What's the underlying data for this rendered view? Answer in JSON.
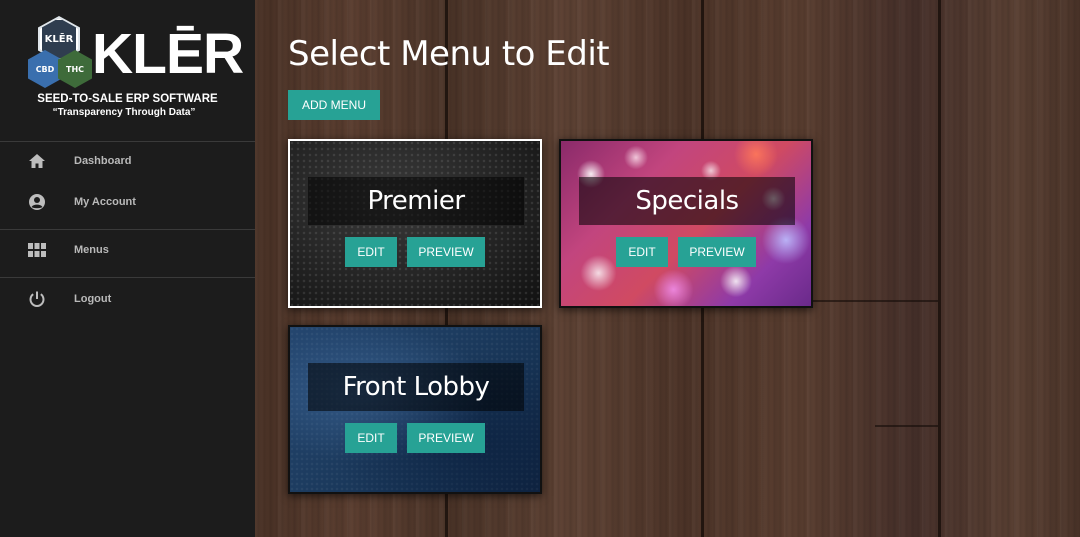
{
  "brand": {
    "logo_hex_label": "KLĒR",
    "logo_cbd": "CBD",
    "logo_thc": "THC",
    "name": "KLĒR",
    "tagline": "SEED-TO-SALE ERP SOFTWARE",
    "motto": "“Transparency Through Data”"
  },
  "sidebar": {
    "items": [
      {
        "label": "Dashboard",
        "icon": "home-icon"
      },
      {
        "label": "My Account",
        "icon": "account-circle-icon"
      },
      {
        "label": "Menus",
        "icon": "grid-icon"
      },
      {
        "label": "Logout",
        "icon": "power-icon"
      }
    ]
  },
  "main": {
    "title": "Select Menu to Edit",
    "add_button": "ADD MENU",
    "cards": [
      {
        "title": "Premier",
        "edit": "EDIT",
        "preview": "PREVIEW"
      },
      {
        "title": "Specials",
        "edit": "EDIT",
        "preview": "PREVIEW"
      },
      {
        "title": "Front Lobby",
        "edit": "EDIT",
        "preview": "PREVIEW"
      }
    ]
  },
  "colors": {
    "accent": "#27a295",
    "sidebar_bg": "#1c1c1c",
    "nav_text": "#b9b9b9"
  }
}
